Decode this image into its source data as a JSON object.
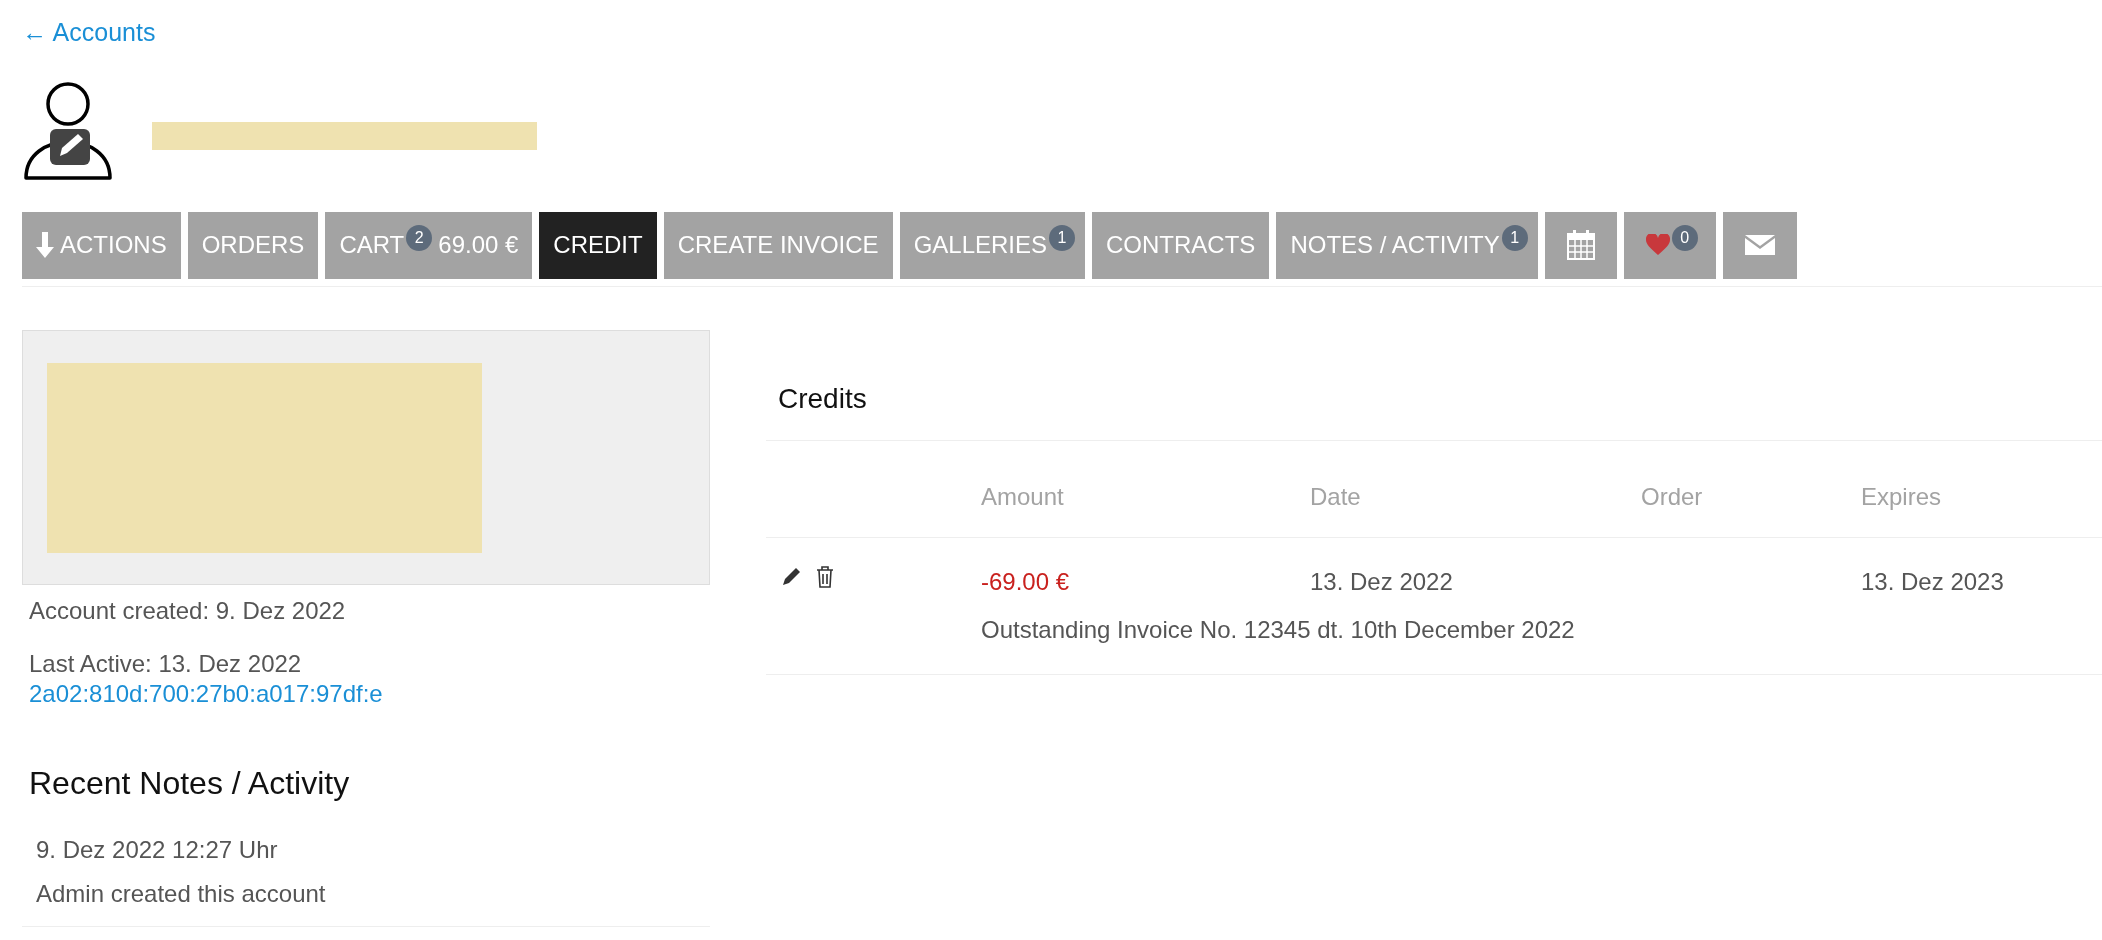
{
  "back_link": {
    "label": "← Accounts"
  },
  "header": {
    "name_redacted": true
  },
  "tabs": [
    {
      "kind": "menu",
      "label": "ACTIONS",
      "selected": false
    },
    {
      "kind": "text",
      "label": "ORDERS",
      "selected": false
    },
    {
      "kind": "text",
      "label": "CART",
      "badge": "2",
      "suffix": "69.00 €",
      "selected": false
    },
    {
      "kind": "text",
      "label": "CREDIT",
      "selected": true
    },
    {
      "kind": "text",
      "label": "CREATE INVOICE",
      "selected": false
    },
    {
      "kind": "text",
      "label": "GALLERIES",
      "badge": "1",
      "selected": false
    },
    {
      "kind": "text",
      "label": "CONTRACTS",
      "selected": false
    },
    {
      "kind": "text",
      "label": "NOTES / ACTIVITY",
      "badge": "1",
      "selected": false
    },
    {
      "kind": "calendar",
      "selected": false
    },
    {
      "kind": "heart",
      "badge": "0",
      "selected": false
    },
    {
      "kind": "mail",
      "selected": false
    }
  ],
  "profile_card": {
    "redacted": true
  },
  "account_info": {
    "created": "Account created: 9. Dez 2022",
    "last_active": "Last Active: 13. Dez 2022",
    "ip_link": "2a02:810d:700:27b0:a017:97df:e"
  },
  "recent_notes": {
    "title": "Recent Notes / Activity",
    "items": [
      {
        "time": "9. Dez 2022 12:27 Uhr",
        "text": "Admin created this account"
      }
    ]
  },
  "credits": {
    "title": "Credits",
    "columns": [
      "Amount",
      "Date",
      "Order",
      "Expires"
    ],
    "rows": [
      {
        "amount": "-69.00 €",
        "negative": true,
        "date": "13. Dez 2022",
        "expires": "13. Dez 2023",
        "note": "Outstanding Invoice No. 12345 dt. 10th December 2022"
      }
    ]
  }
}
